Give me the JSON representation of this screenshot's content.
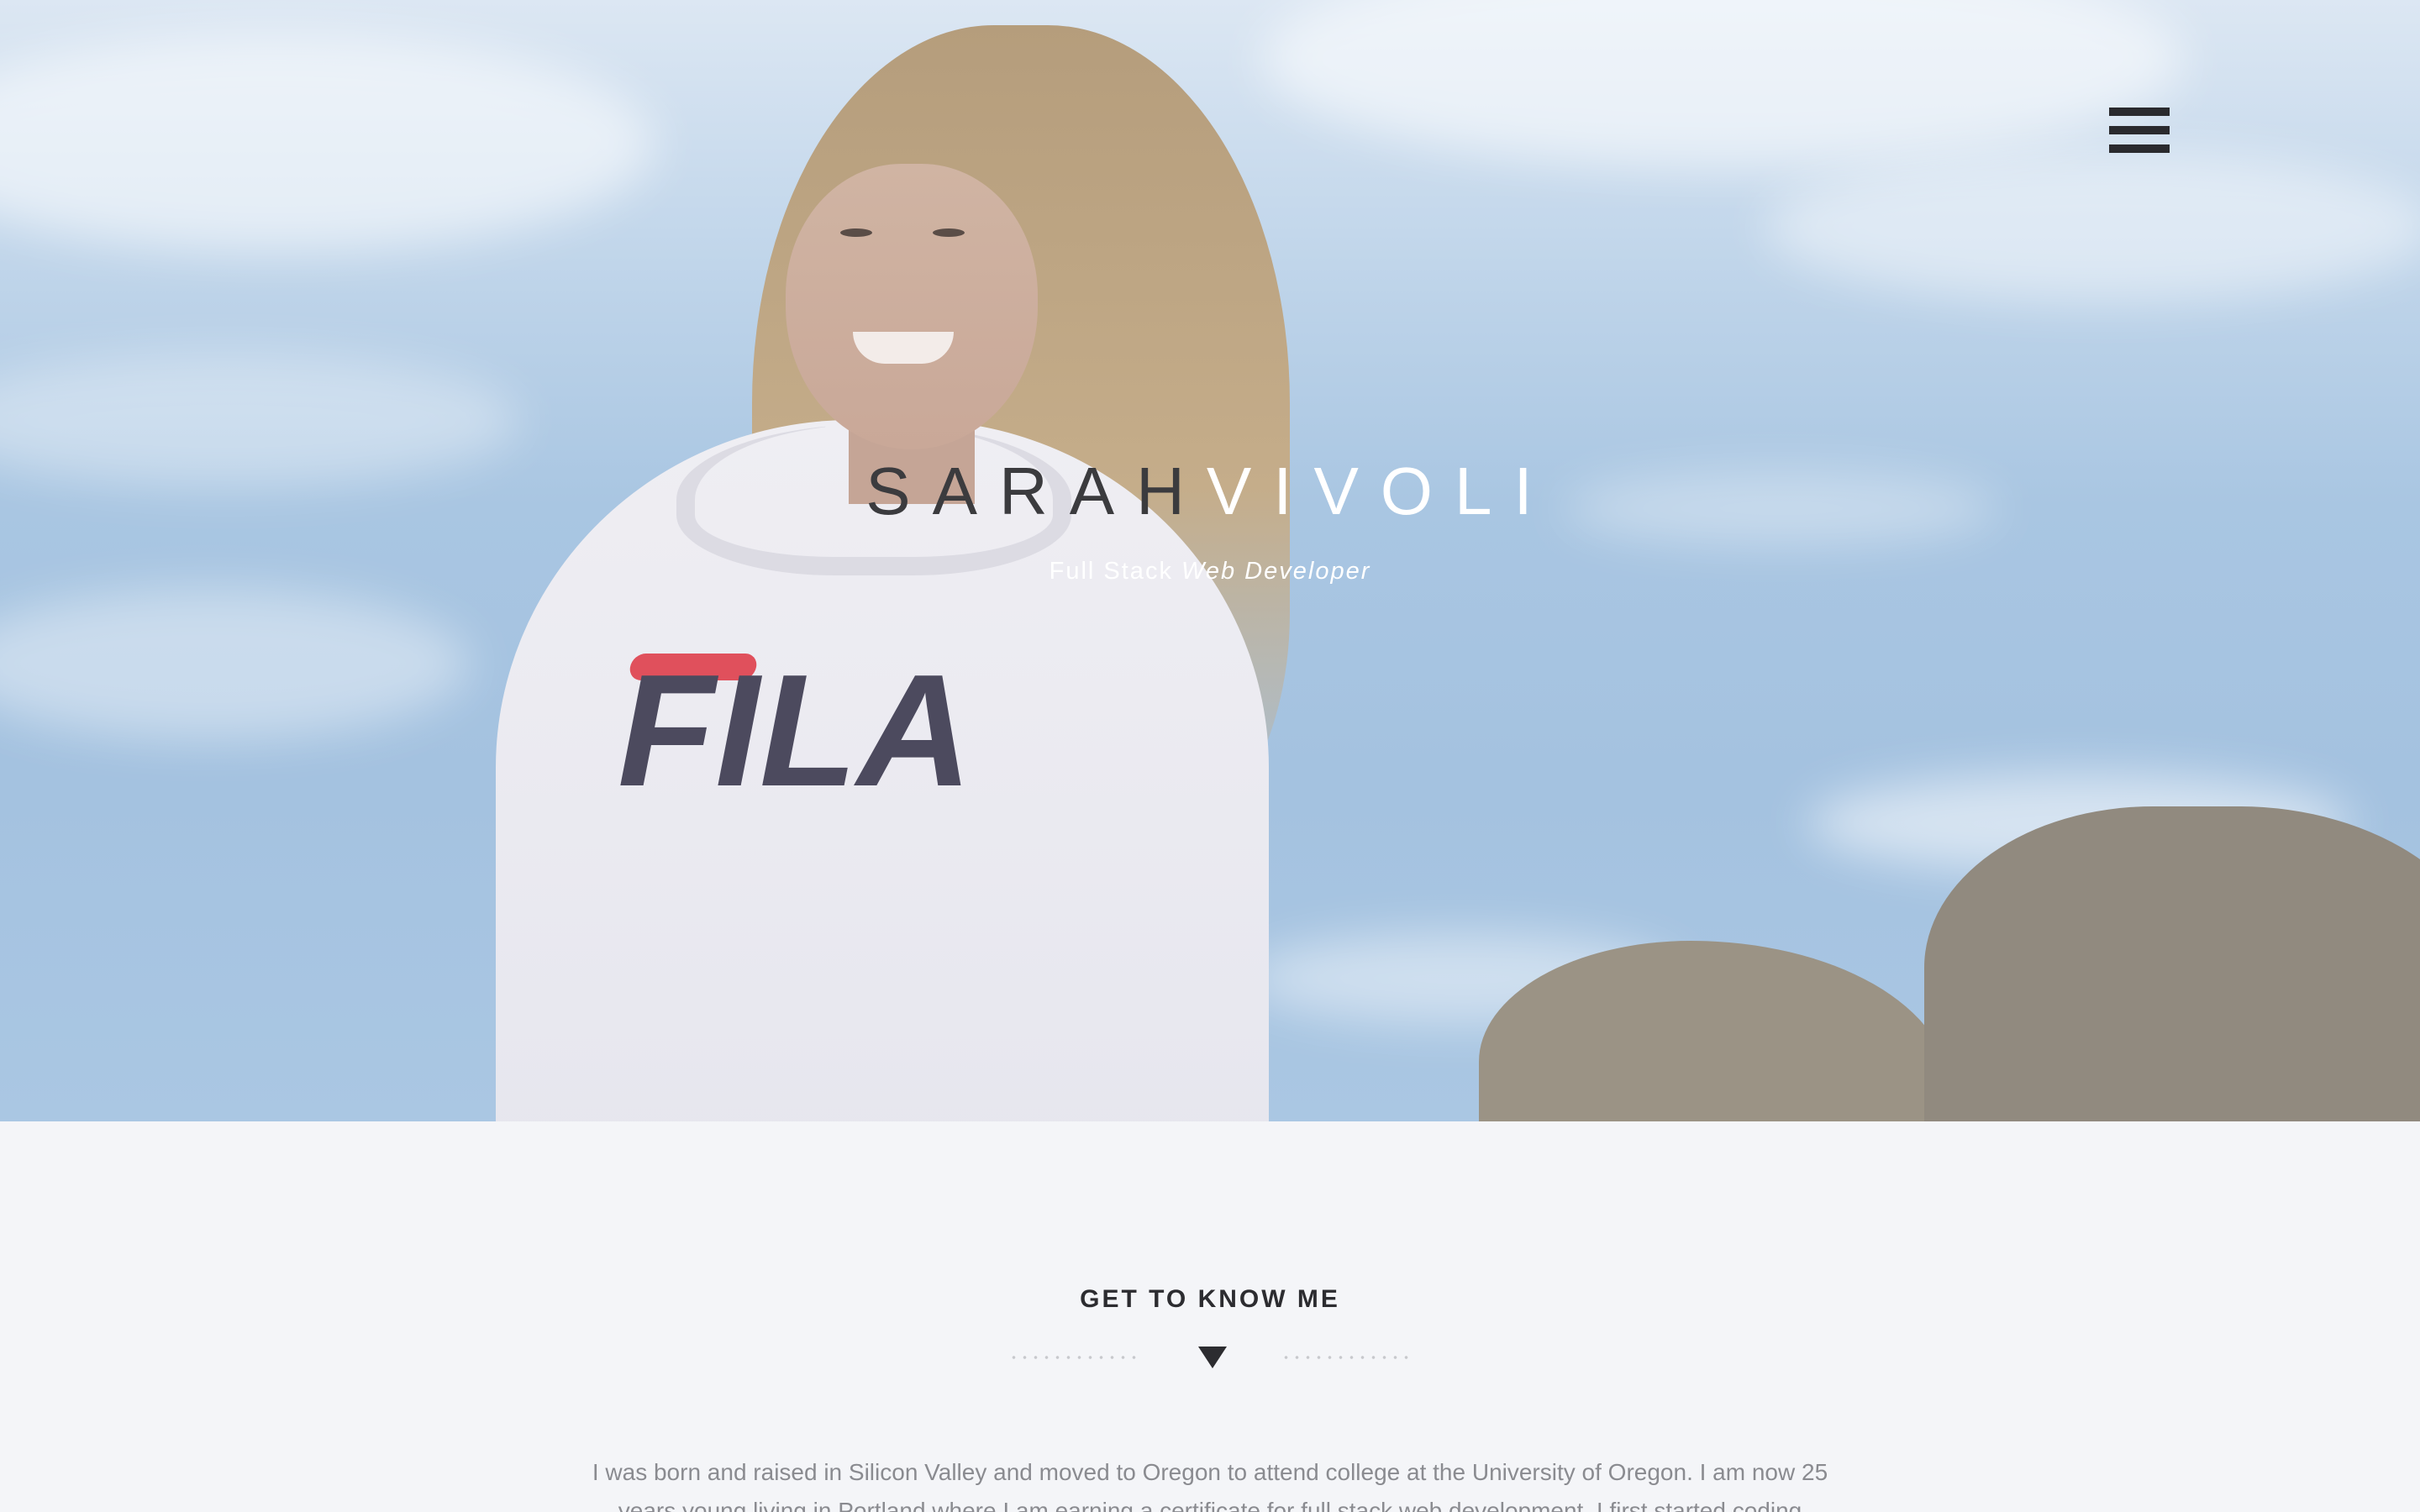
{
  "header": {
    "menu_icon": "hamburger-menu-icon"
  },
  "hero": {
    "first_name": "SARAH",
    "last_name": "VIVOLI",
    "subtitle_plain": "Full Stack",
    "subtitle_italic": "Web Developer",
    "photo_logo_text": "FILA"
  },
  "about": {
    "heading": "GET TO KNOW ME",
    "divider_icon": "triangle-down-icon",
    "paragraph": "I was born and raised in Silicon Valley and moved to Oregon to attend college at the University of Oregon. I am now 25 years young living in Portland where I am earning a certificate for full stack web development. I first started coding"
  },
  "colors": {
    "accent_dark": "#2c2c30",
    "body_bg": "#f4f5f8",
    "text_muted": "#8a8b90",
    "sky": "#a9c6e2"
  }
}
